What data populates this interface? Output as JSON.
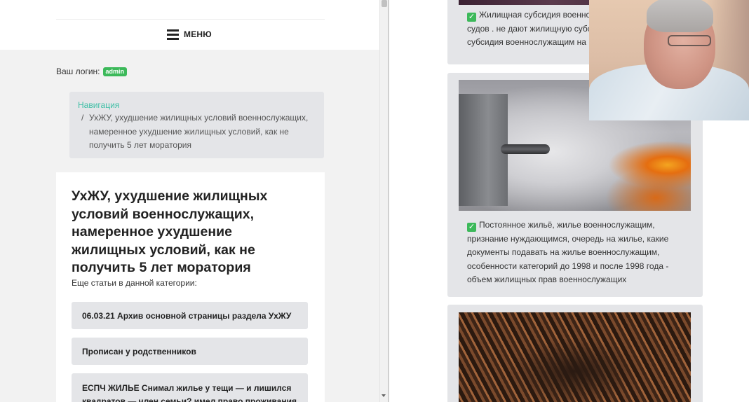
{
  "header": {
    "menu_label": "МЕНЮ"
  },
  "login": {
    "label": "Ваш логин:",
    "username": "admin"
  },
  "breadcrumb": {
    "nav_link": "Навигация",
    "separator": "/",
    "current": "УхЖУ, ухудшение жилищных условий военнослужащих, намеренное ухудшение жилищных условий, как не получить 5 лет моратория"
  },
  "article": {
    "title": "УхЖУ, ухудшение жилищных условий военнослужащих, намеренное ухудшение жилищных условий, как не получить 5 лет моратория",
    "more_label": "Еще статьи в данной категории:",
    "related": [
      "06.03.21 Архив основной страницы раздела УхЖУ",
      "Прописан у родственников",
      "ЕСПЧ ЖИЛЬЕ Снимал жилье у тещи — и лишился квадратов — член семьи? имел право проживания ?"
    ]
  },
  "right_cards": [
    {
      "check": "✓",
      "text": "Жилищная субсидия военнослужащим, решения судов . не дают жилищную субсидию, жилищная субсидия военнослужащим на"
    },
    {
      "check": "✓",
      "text": "Постоянное жильё, жилье военнослужащим, признание нуждающимся, очередь на жилье, какие документы подавать на жилье военнослужащим, особенности категорий до 1998 и после 1998 года - объем жилищных прав военнослужащих"
    }
  ],
  "colors": {
    "accent_link": "#3fbfa6",
    "badge_green": "#3cb95a",
    "card_bg": "#e4e5e8"
  }
}
